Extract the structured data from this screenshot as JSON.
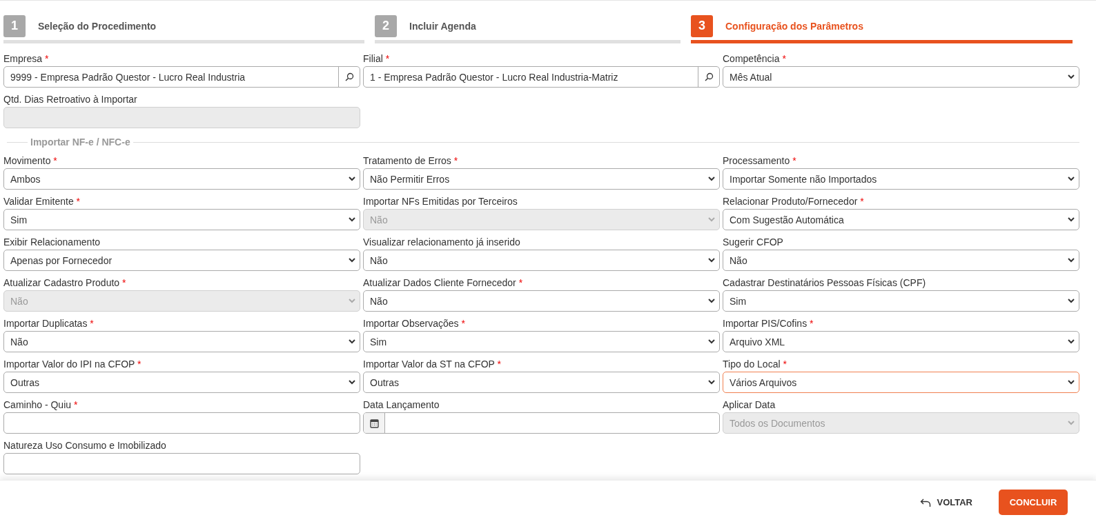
{
  "steps": [
    {
      "number": "1",
      "title": "Seleção do Procedimento",
      "selected": false
    },
    {
      "number": "2",
      "title": "Incluir Agenda",
      "selected": false
    },
    {
      "number": "3",
      "title": "Configuração dos Parâmetros",
      "selected": true
    }
  ],
  "general_fields": [
    {
      "kind": "lookup",
      "label": "Empresa",
      "required_mark": "*",
      "value": "9999 - Empresa Padrão Questor - Lucro Real Industria",
      "disabled": false
    },
    {
      "kind": "lookup",
      "label": "Filial",
      "required_mark": "*",
      "value": "1 - Empresa Padrão Questor - Lucro Real Industria-Matriz",
      "disabled": false
    },
    {
      "kind": "select",
      "label": "Competência",
      "required_mark": "*",
      "value": "Mês Atual",
      "disabled": false
    },
    {
      "kind": "text",
      "label": "Qtd. Dias Retroativo à Importar",
      "disabled": true
    }
  ],
  "import_section": {
    "legend": "Importar NF-e / NFC-e",
    "fields": [
      {
        "kind": "select",
        "label": "Movimento",
        "required_mark": "*",
        "value": "Ambos",
        "disabled": false
      },
      {
        "kind": "select",
        "label": "Tratamento de Erros",
        "required_mark": "*",
        "value": "Não Permitir Erros",
        "disabled": false
      },
      {
        "kind": "select",
        "label": "Processamento",
        "required_mark": "*",
        "value": "Importar Somente não Importados",
        "disabled": false
      },
      {
        "kind": "select",
        "label": "Validar Emitente",
        "required_mark": "*",
        "value": "Sim",
        "disabled": false
      },
      {
        "kind": "select",
        "label": "Importar NFs Emitidas por Terceiros",
        "value": "Não",
        "disabled": true
      },
      {
        "kind": "select",
        "label": "Relacionar Produto/Fornecedor",
        "required_mark": "*",
        "value": "Com Sugestão Automática",
        "disabled": false
      },
      {
        "kind": "select",
        "label": "Exibir Relacionamento",
        "value": "Apenas por Fornecedor",
        "disabled": false
      },
      {
        "kind": "select",
        "label": "Visualizar relacionamento já inserido",
        "value": "Não",
        "disabled": false
      },
      {
        "kind": "select",
        "label": "Sugerir CFOP",
        "value": "Não",
        "disabled": false
      },
      {
        "kind": "select",
        "label": "Atualizar Cadastro Produto",
        "required_mark": "*",
        "value": "Não",
        "disabled": true
      },
      {
        "kind": "select",
        "label": "Atualizar Dados Cliente Fornecedor",
        "required_mark": "*",
        "value": "Não",
        "disabled": false
      },
      {
        "kind": "select",
        "label": "Cadastrar Destinatários Pessoas Físicas (CPF)",
        "value": "Sim",
        "disabled": false
      },
      {
        "kind": "select",
        "label": "Importar Duplicatas",
        "required_mark": "*",
        "value": "Não",
        "disabled": false
      },
      {
        "kind": "select",
        "label": "Importar Observações",
        "required_mark": "*",
        "value": "Sim",
        "disabled": false
      },
      {
        "kind": "select",
        "label": "Importar PIS/Cofins",
        "required_mark": "*",
        "value": "Arquivo XML",
        "disabled": false
      },
      {
        "kind": "select",
        "label": "Importar Valor do IPI na CFOP",
        "required_mark": "*",
        "value": "Outras",
        "disabled": false
      },
      {
        "kind": "select",
        "label": "Importar Valor da ST na CFOP",
        "required_mark": "*",
        "value": "Outras",
        "disabled": false
      },
      {
        "kind": "select",
        "label": "Tipo do Local",
        "required_mark": "*",
        "value": "Vários Arquivos",
        "disabled": false,
        "focused": true
      },
      {
        "kind": "text",
        "label": "Caminho - Quiu",
        "required_mark": "*",
        "disabled": false
      },
      {
        "kind": "date",
        "label": "Data Lançamento",
        "disabled": false
      },
      {
        "kind": "select",
        "label": "Aplicar Data",
        "value": "Todos os Documentos",
        "disabled": true
      },
      {
        "kind": "text",
        "label": "Natureza Uso Consumo e Imobilizado",
        "disabled": false
      }
    ]
  },
  "footer": {
    "back_button": "VOLTAR",
    "finish_button": "CONCLUIR"
  }
}
